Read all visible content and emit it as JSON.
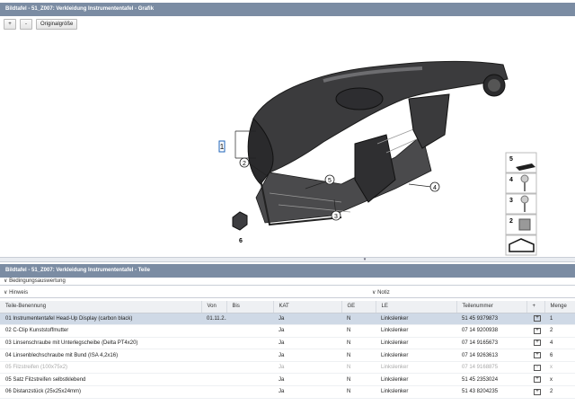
{
  "graphic_panel": {
    "title": "Bildtafel - 51_Z007: Verkleidung Instrumententafel - Grafik",
    "toolbar": {
      "zoom_in": "+",
      "zoom_out": "-",
      "original_size": "Originalgröße"
    },
    "callouts": [
      "1",
      "2",
      "3",
      "4",
      "5",
      "6"
    ],
    "thumbnails": [
      "5",
      "4",
      "3",
      "2",
      ""
    ]
  },
  "parts_panel": {
    "title": "Bildtafel - 51_Z007: Verkleidung Instrumententafel - Teile",
    "condition_label": "Bedingungsauswertung",
    "hints_label": "Hinweis",
    "notes_label": "Notiz",
    "columns": [
      "Teile-Benennung",
      "Von",
      "Bis",
      "KAT",
      "GE",
      "LE",
      "Teilenummer",
      "+",
      "Menge"
    ],
    "rows": [
      {
        "name": "01 Instrumententafel Head-Up Display (carbon black)",
        "from": "01.11.2...",
        "to": "",
        "kat": "Ja",
        "ge": "N",
        "le": "Linkslenker",
        "part_no": "51 45 9379873",
        "qty": "1",
        "cart": "+",
        "selected": true,
        "greyed": false
      },
      {
        "name": "02 C-Clip Kunststoffmutter",
        "from": "",
        "to": "",
        "kat": "Ja",
        "ge": "N",
        "le": "Linkslenker",
        "part_no": "07 14 9200938",
        "qty": "2",
        "cart": "+",
        "selected": false,
        "greyed": false
      },
      {
        "name": "03 Linsenschraube mit Unterlegscheibe (Delta PT4x20)",
        "from": "",
        "to": "",
        "kat": "Ja",
        "ge": "N",
        "le": "Linkslenker",
        "part_no": "07 14 9165673",
        "qty": "4",
        "cart": "+",
        "selected": false,
        "greyed": false
      },
      {
        "name": "04 Linsenblechschraube mit Bund (ISA 4,2x16)",
        "from": "",
        "to": "",
        "kat": "Ja",
        "ge": "N",
        "le": "Linkslenker",
        "part_no": "07 14 9263613",
        "qty": "6",
        "cart": "+",
        "selected": false,
        "greyed": false
      },
      {
        "name": "05 Filzstreifen (100x75x2)",
        "from": "",
        "to": "",
        "kat": "Ja",
        "ge": "N",
        "le": "Linkslenker",
        "part_no": "07 14 9168875",
        "qty": "x",
        "cart": "+",
        "selected": false,
        "greyed": true
      },
      {
        "name": "05 Satz Filzstreifen selbstklebend",
        "from": "",
        "to": "",
        "kat": "Ja",
        "ge": "N",
        "le": "Linkslenker",
        "part_no": "51 45 2353024",
        "qty": "x",
        "cart": "+",
        "selected": false,
        "greyed": false
      },
      {
        "name": "06 Distanzstück (25x25x24mm)",
        "from": "",
        "to": "",
        "kat": "Ja",
        "ge": "N",
        "le": "Linkslenker",
        "part_no": "51 43 8204235",
        "qty": "2",
        "cart": "+",
        "selected": false,
        "greyed": false
      }
    ]
  },
  "splitter_arrow": "▾"
}
